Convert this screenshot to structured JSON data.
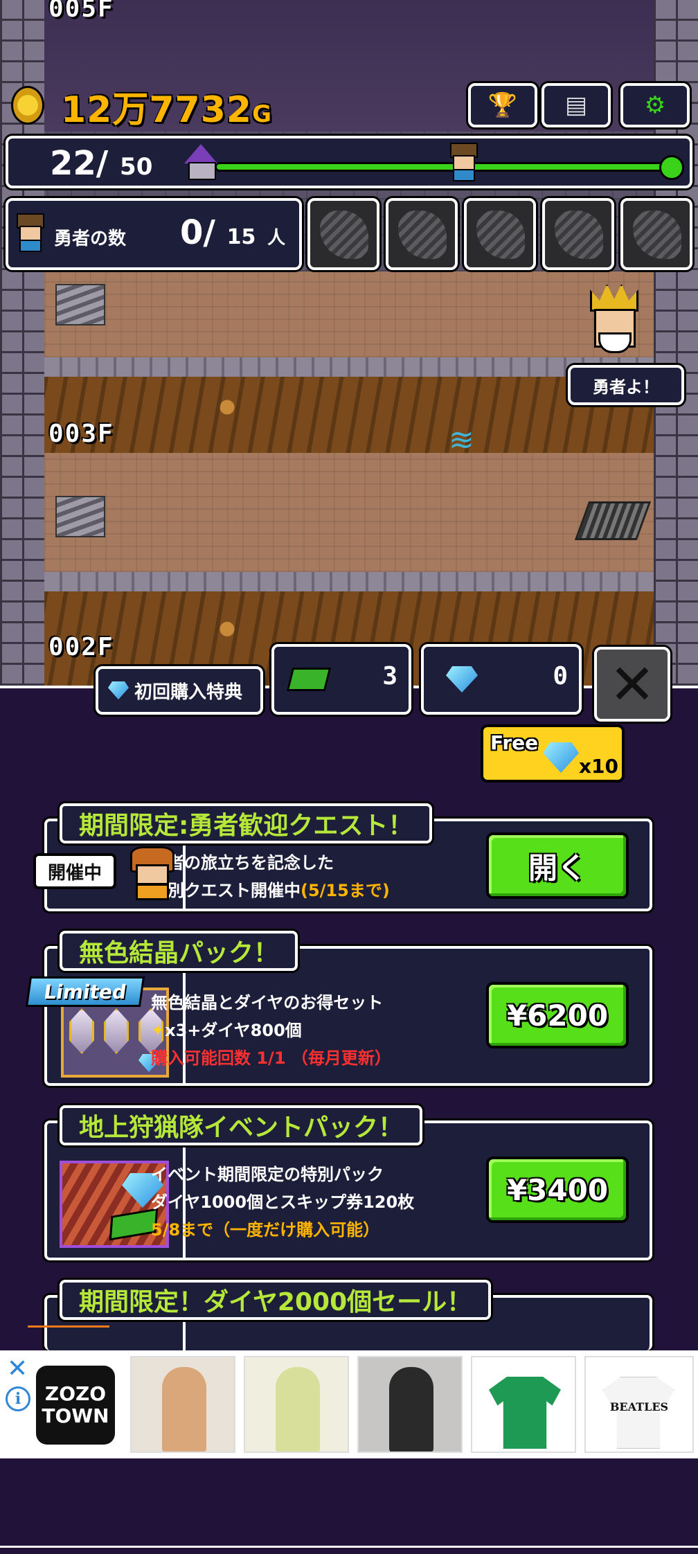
{
  "hud": {
    "gold": "12万7732",
    "gold_unit": "G",
    "alert_mark": "!",
    "trophy_icon": "🏆",
    "menu_icon": "▤",
    "settings_icon": "⚙"
  },
  "floors": {
    "top_label": "005F",
    "mid_label": "003F",
    "low_label": "002F"
  },
  "speech": "勇者よ！",
  "progress": {
    "current": "22",
    "slash": "/",
    "total": "50",
    "fraction": 0.44
  },
  "heroes": {
    "label": "勇者の数",
    "current": "0",
    "slash": "/",
    "max": "15",
    "unit": "人"
  },
  "monsters": [
    "monster-slot-1",
    "monster-slot-2",
    "monster-slot-3",
    "monster-slot-4",
    "monster-slot-5"
  ],
  "shop": {
    "first_purchase_tab": "初回購入特典",
    "tickets": "3",
    "diamonds": "0",
    "close": "✕",
    "free_label": "Free",
    "free_mult": "x10",
    "cards": [
      {
        "title": "期間限定:勇者歓迎クエスト！",
        "badge": "開催中",
        "line1": "勇者の旅立ちを記念した",
        "line2": "特別クエスト開催中",
        "line2_hl": "(5/15まで)",
        "button": "開く"
      },
      {
        "title": "無色結晶パック！",
        "badge": "Limited",
        "line1": "無色結晶とダイヤのお得セット",
        "line2": "x3+ダイヤ800個",
        "line3": "購入可能回数 1/1 （毎月更新）",
        "button": "¥6200"
      },
      {
        "title": "地上狩猟隊イベントパック！",
        "line1": "イベント期間限定の特別パック",
        "line2": "ダイヤ1000個とスキップ券120枚",
        "line3": "5/8まで（一度だけ購入可能）",
        "button": "¥3400"
      },
      {
        "title": "期間限定！ダイヤ2000個セール！"
      }
    ]
  },
  "ad": {
    "close": "✕",
    "info": "i",
    "logo_line1": "ZOZO",
    "logo_line2": "TOWN",
    "shirt_text": "BEATLES",
    "colors": {
      "shirt_green": "#1f9a55",
      "accent": "#2f86d6"
    }
  },
  "colors": {
    "panel": "#1d1f3a",
    "title_green": "#b6e83a",
    "gold": "#ffb400",
    "button_green": "#57e01a",
    "background": "#201238"
  }
}
